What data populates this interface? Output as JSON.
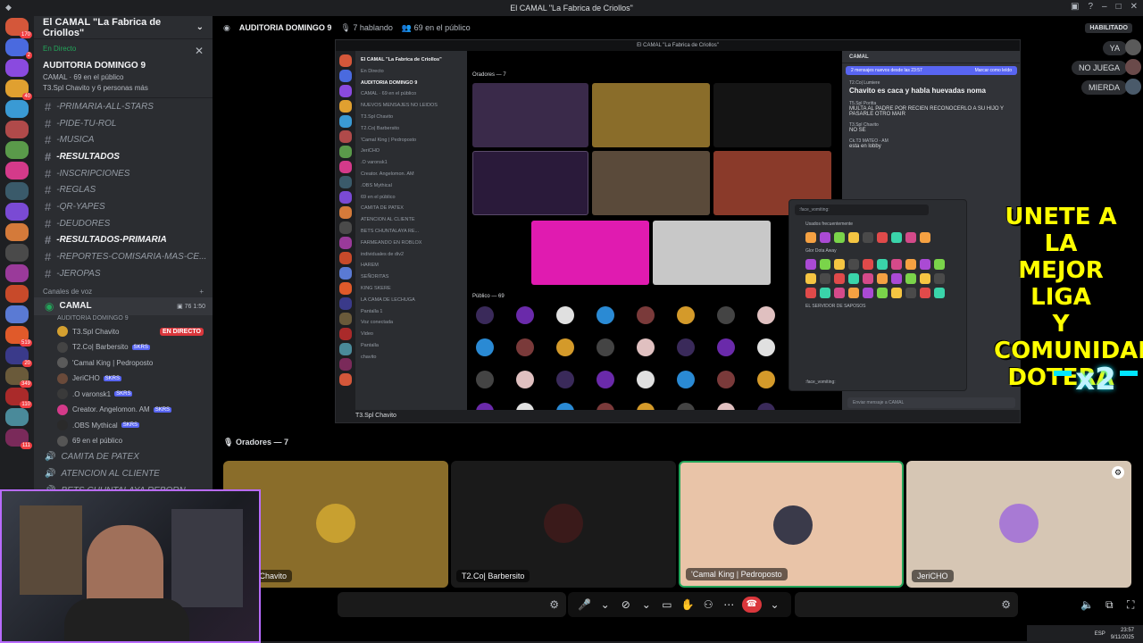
{
  "window": {
    "title": "El CAMAL \"La Fabrica de Criollos\"",
    "habilitado": "HABILITADO"
  },
  "guild_badges": [
    "170",
    "2",
    "",
    "40",
    "",
    "",
    "",
    "",
    "",
    "",
    "",
    "",
    "",
    "",
    "",
    "519",
    "20",
    "349",
    "110",
    "",
    "111"
  ],
  "server": {
    "name": "El CAMAL \"La Fabrica de Criollos\"",
    "stage_live": "En Directo",
    "stage_title": "AUDITORIA DOMINGO 9",
    "stage_meta": "CAMAL · 69 en el público",
    "stage_people": "T3.Spl Chavito y 6 personas más"
  },
  "channels": [
    {
      "name": "-PRIMARIA-ALL-STARS",
      "bold": false
    },
    {
      "name": "-PIDE-TU-ROL",
      "bold": false
    },
    {
      "name": "-MUSICA",
      "bold": false
    },
    {
      "name": "-RESULTADOS",
      "bold": true
    },
    {
      "name": "-INSCRIPCIONES",
      "bold": false
    },
    {
      "name": "-REGLAS",
      "bold": false
    },
    {
      "name": "-QR-YAPES",
      "bold": false
    },
    {
      "name": "-DEUDORES",
      "bold": false
    },
    {
      "name": "-RESULTADOS-PRIMARIA",
      "bold": true
    },
    {
      "name": "-REPORTES-COMISARIA-MAS-CE...",
      "bold": false
    },
    {
      "name": "-JEROPAS",
      "bold": false
    }
  ],
  "voice_category": "Canales de voz",
  "voice_channel": {
    "name": "CAMAL",
    "sub": "AUDITORIA DOMINGO 9",
    "count": "76",
    "time": "1:50"
  },
  "voice_users": [
    {
      "name": "T3.Spl Chavito",
      "live": "EN DIRECTO",
      "tag": ""
    },
    {
      "name": "T2.Co| Barbersito",
      "live": "",
      "tag": "SKRS"
    },
    {
      "name": "'Camal King | Pedroposto",
      "live": "",
      "tag": ""
    },
    {
      "name": "JeriCHO",
      "live": "",
      "tag": "SKRS"
    },
    {
      "name": ".O varonsk1",
      "live": "",
      "tag": "SKRS"
    },
    {
      "name": "Creator. Angelomon. AM",
      "live": "",
      "tag": "SKRS"
    },
    {
      "name": ".OBS Mythical",
      "live": "",
      "tag": "SKRS"
    },
    {
      "name": "69 en el público",
      "live": "",
      "tag": ""
    }
  ],
  "more_channels": [
    {
      "name": "CAMITA DE PATEX"
    },
    {
      "name": "ATENCION AL CLIENTE"
    },
    {
      "name": "BETS CHUNTALAYA REBORN ..."
    }
  ],
  "stage_header": {
    "title": "AUDITORIA DOMINGO 9",
    "speaking": "7 hablando",
    "audience": "69 en el público"
  },
  "inner": {
    "title": "El CAMAL \"La Fabrica de Criollos\"",
    "speakers_header": "Oradores — 7",
    "audience_header": "Público — 69",
    "footer_user": "T3.Spl Chavito",
    "channels": [
      "El CAMAL \"La Fabrica de Criollos\"",
      "En Directo",
      "AUDITORIA DOMINGO 9",
      "CAMAL · 69 en el público",
      "NUEVOS MENSAJES NO LEIDOS",
      "T3.Spl Chavito",
      "T2.Co| Barbersito",
      "'Camal King | Pedroposto",
      "JeriCHO",
      ".O varonsk1",
      "Creator. Angelomon. AM",
      ".OBS Mythical",
      "69 en el público",
      "CAMITA DE PATEX",
      "ATENCION AL CLIENTE",
      "BETS CHUNTALAYA RE...",
      "FARMEANDO EN ROBLOX",
      "individuales de div2",
      "HAREM",
      "SEÑORITAS",
      "KING SKERE",
      "LA CAMA DE LECHUGA",
      "Pantalla 1",
      "Voz conectada",
      "Video",
      "Pantalla",
      "chavito"
    ],
    "chat_header": "CAMAL",
    "banner_left": "2 mensajes nuevos desde las 23:57",
    "banner_right": "Marcar como leído",
    "messages": [
      {
        "user": "T2.Co| Lumiere",
        "text": "Chavito es caca y habla huevadas noma",
        "big": true
      },
      {
        "user": "T5.Spl Poritta",
        "text": "MULTA AL PADRE POR RECIEN RECONOCERLO A SU HIJO Y PASARLE OTRO MAIR",
        "big": false
      },
      {
        "user": "T3.Spl Chavito",
        "text": "NO SE",
        "big": false
      },
      {
        "user": "Ck.T3 MATEO - AM",
        "text": "esta en lobby",
        "big": false
      }
    ],
    "emoji_search": ":face_vomiting:",
    "emoji_section1": "Usados frecuentemente",
    "emoji_section2": "Glor Dota Away",
    "emoji_section3": "EL SERVIDOR DE SAPOSOS",
    "emoji_footer": ":face_vomiting:",
    "chat_input": "Enviar mensaje a CAMAL"
  },
  "promo": {
    "line1": "UNETE A LA",
    "line2": "MEJOR LIGA",
    "line3": "Y COMUNIDAD",
    "line4": "DOTERA",
    "x2": "x2"
  },
  "side_replies": [
    "YA",
    "NO JUEGA",
    "MIERDA"
  ],
  "speakers_header": "Oradores — 7",
  "tiles": [
    {
      "name": "T3.Spl Chavito",
      "bg": "#8a6d2a"
    },
    {
      "name": "T2.Co| Barbersito",
      "bg": "#1a1a1a"
    },
    {
      "name": "'Camal King | Pedroposto",
      "bg": "#e9c4a8"
    },
    {
      "name": "JeriCHO",
      "bg": "#d6c6b4"
    }
  ],
  "taskbar": {
    "lang": "ESP",
    "time": "23:57",
    "date": "9/11/2025"
  }
}
